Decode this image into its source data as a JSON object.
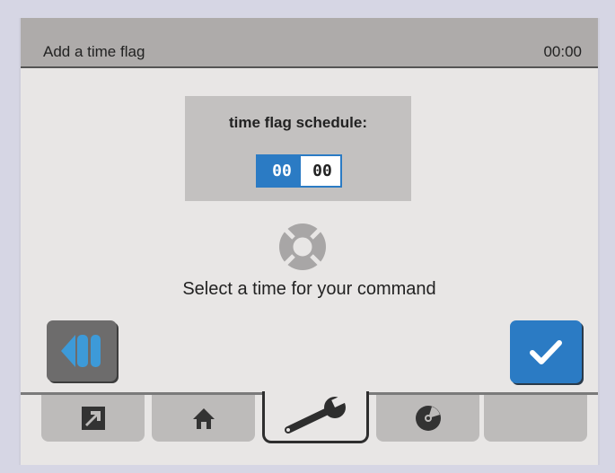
{
  "header": {
    "title": "Add a time flag",
    "clock": "00:00"
  },
  "schedule": {
    "label": "time flag schedule:",
    "hours": "00",
    "separator": ":",
    "minutes": "00"
  },
  "help": {
    "icon": "lifebuoy-icon"
  },
  "instruction": "Select a time for your command",
  "buttons": {
    "back_icon": "back-icon",
    "confirm_icon": "checkmark-icon"
  },
  "tabs": [
    {
      "icon": "arrow-out-icon"
    },
    {
      "icon": "home-icon"
    },
    {
      "icon": "wrench-icon",
      "active": true
    },
    {
      "icon": "disc-icon"
    },
    {
      "icon": "empty"
    }
  ],
  "colors": {
    "accent": "#2b7bc4",
    "titlebar": "#aeabaa",
    "panel": "#e8e6e5",
    "tab": "#bdbbba"
  }
}
